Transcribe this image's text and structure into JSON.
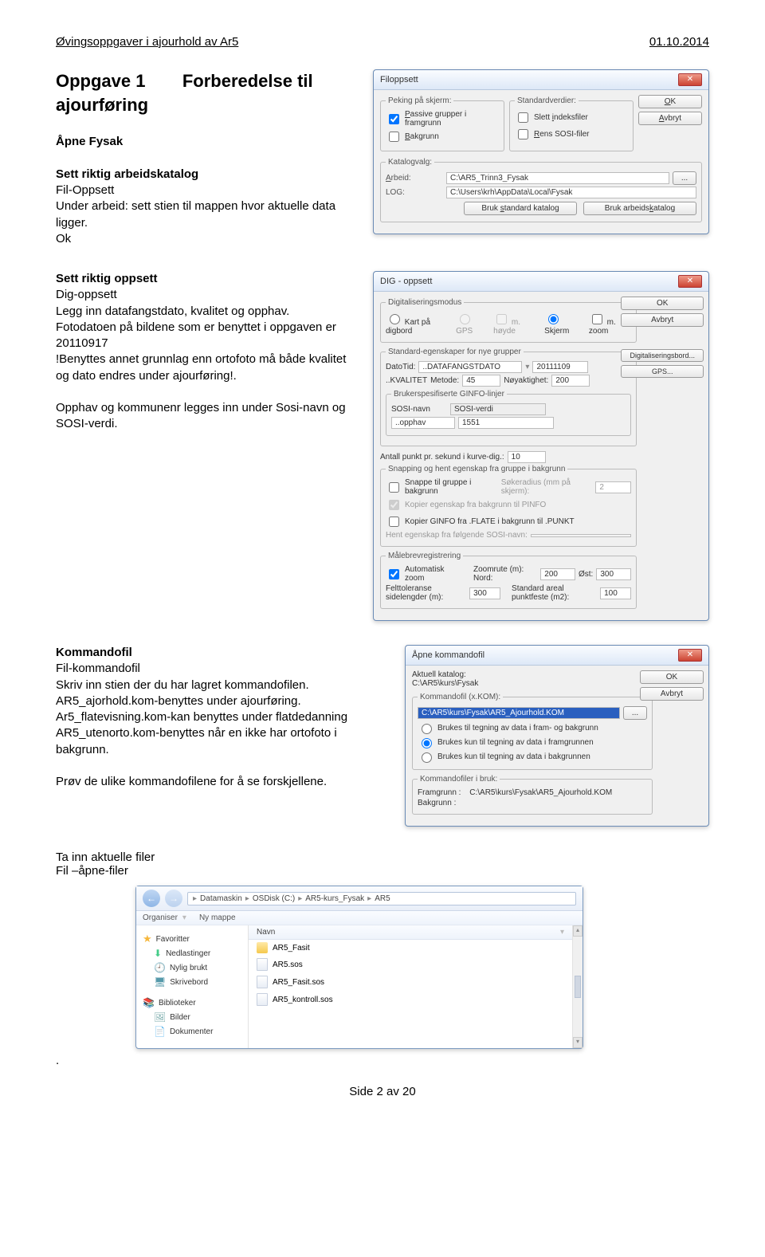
{
  "header": {
    "left": "Øvingsoppgaver i ajourhold av Ar5",
    "right": "01.10.2014"
  },
  "section1": {
    "title": "Oppgave 1",
    "subtitle": "Forberedelse til ajourføring",
    "open": "Åpne Fysak",
    "set_catalog": "Sett riktig arbeidskatalog",
    "fil_oppsett": "Fil-Oppsett",
    "under_arbeid": "Under arbeid: sett stien til mappen hvor aktuelle data ligger.",
    "ok": "Ok"
  },
  "filoppsett": {
    "title": "Filoppsett",
    "peking": "Peking på skjerm:",
    "passive": "Passive grupper i framgrunn",
    "passive_u": "P",
    "bakgrunn": "Bakgrunn",
    "bakgrunn_u": "B",
    "standard": "Standardverdier:",
    "slett": "Slett indeksfiler",
    "slett_u": "i",
    "rens": "Rens SOSI-filer",
    "rens_u": "R",
    "katalogvalg": "Katalogvalg:",
    "arbeid_lbl": "Arbeid:",
    "arbeid_u": "A",
    "arbeid_val": "C:\\AR5_Trinn3_Fysak",
    "log_lbl": "LOG:",
    "log_val": "C:\\Users\\krh\\AppData\\Local\\Fysak",
    "btn_std": "Bruk standard katalog",
    "btn_std_u": "s",
    "btn_arb": "Bruk arbeidskatalog",
    "btn_arb_u": "k",
    "ok": "OK",
    "ok_u": "O",
    "avbryt": "Avbryt",
    "avbryt_u": "A",
    "dots": "..."
  },
  "section2": {
    "set_opp": "Sett riktig oppsett",
    "dig": "Dig-oppsett",
    "legg": "Legg inn datafangstdato, kvalitet og opphav.",
    "foto": "Fotodatoen på bildene som er benyttet i oppgaven er 20110917",
    "benyttes": "!Benyttes annet grunnlag enn ortofoto må både kvalitet og dato endres under ajourføring!.",
    "opphav": "Opphav og kommunenr legges inn under Sosi-navn og SOSI-verdi."
  },
  "dig": {
    "title": "DIG - oppsett",
    "modus": "Digitaliseringsmodus",
    "kart": "Kart på digbord",
    "gps": "GPS",
    "hoyde": "m. høyde",
    "skjerm": "Skjerm",
    "zoom": "m. zoom",
    "stdeg": "Standard-egenskaper for nye grupper",
    "datotid_lbl": "DatoTid:",
    "datotid_name": "..DATAFANGSTDATO",
    "datotid_val": "20111109",
    "kval_lbl": "..KVALITET",
    "metode_lbl": "Metode:",
    "metode_val": "45",
    "noy_lbl": "Nøyaktighet:",
    "noy_val": "200",
    "digbord": "Digitaliseringsbord...",
    "gpsbtn": "GPS...",
    "bruker": "Brukerspesifiserte GINFO-linjer",
    "sosi_navn": "SOSI-navn",
    "sosi_verdi": "SOSI-verdi",
    "opphav": "..opphav",
    "opphav_val": "1551",
    "antall_lbl": "Antall punkt pr. sekund i kurve-dig.:",
    "antall_val": "10",
    "snapping_grp": "Snapping og hent egenskap fra gruppe i bakgrunn",
    "snappe": "Snappe til gruppe i bakgrunn",
    "sokeradius": "Søkeradius (mm på skjerm):",
    "sokeradius_val": "2",
    "kopier_eg": "Kopier egenskap fra bakgrunn til PINFO",
    "kopier_ginfo": "Kopier GINFO fra .FLATE i bakgrunn til .PUNKT",
    "hent": "Hent egenskap fra følgende SOSI-navn:",
    "malebrev": "Målebrevregistrering",
    "auto_zoom": "Automatisk zoom",
    "zoomrute_lbl": "Zoomrute (m): Nord:",
    "zoomrute_n": "200",
    "ost_lbl": "Øst:",
    "ost_val": "300",
    "felt_lbl": "Felttoleranse sidelengder (m):",
    "felt_val": "300",
    "std_areal_lbl": "Standard areal punktfeste (m2):",
    "std_areal_val": "100",
    "ok": "OK",
    "avbryt": "Avbryt"
  },
  "section3": {
    "kommandofil": "Kommandofil",
    "filk": "Fil-kommandofil",
    "skriv": "Skriv inn stien der du har lagret kommandofilen.",
    "ar5a": "AR5_ajorhold.kom-benyttes under ajourføring.",
    "ar5f": "Ar5_flatevisning.kom-kan benyttes under flatdedanning",
    "ar5u": "AR5_utenorto.kom-benyttes når en ikke har ortofoto i bakgrunn.",
    "prov": "Prøv de ulike kommandofilene for å se forskjellene."
  },
  "apne": {
    "title": "Åpne kommandofil",
    "aktuell": "Aktuell katalog:",
    "katalog": "C:\\AR5\\kurs\\Fysak",
    "grp": "Kommandofil (x.KOM):",
    "path": "C:\\AR5\\kurs\\Fysak\\AR5_Ajourhold.KOM",
    "r1": "Brukes til tegning av data i fram- og bakgrunn",
    "r2": "Brukes kun til tegning av data i framgrunnen",
    "r3": "Brukes kun til tegning av data i bakgrunnen",
    "ibruk": "Kommandofiler i bruk:",
    "framgrunn_lbl": "Framgrunn :",
    "framgrunn_val": "C:\\AR5\\kurs\\Fysak\\AR5_Ajourhold.KOM",
    "bakgrunn_lbl": "Bakgrunn :",
    "ok": "OK",
    "avbryt": "Avbryt",
    "dots": "..."
  },
  "section4": {
    "ta_inn": "Ta inn aktuelle filer",
    "fil_apne": "Fil –åpne-filer"
  },
  "browser": {
    "organiser": "Organiser",
    "nymappe": "Ny mappe",
    "navn": "Navn",
    "path": [
      "Datamaskin",
      "OSDisk (C:)",
      "AR5-kurs_Fysak",
      "AR5"
    ],
    "fav": "Favoritter",
    "dl": "Nedlastinger",
    "nylig": "Nylig brukt",
    "desk": "Skrivebord",
    "bib": "Biblioteker",
    "bilder": "Bilder",
    "dok": "Dokumenter",
    "files": [
      "AR5_Fasit",
      "AR5.sos",
      "AR5_Fasit.sos",
      "AR5_kontroll.sos"
    ]
  },
  "footer": "Side 2 av 20"
}
